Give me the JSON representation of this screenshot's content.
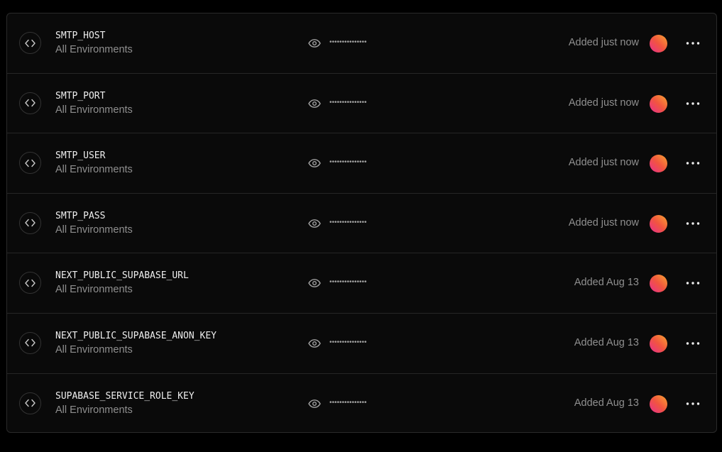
{
  "variables": [
    {
      "name": "SMTP_HOST",
      "environment": "All Environments",
      "masked_value": "•••••••••••••••",
      "added": "Added just now"
    },
    {
      "name": "SMTP_PORT",
      "environment": "All Environments",
      "masked_value": "•••••••••••••••",
      "added": "Added just now"
    },
    {
      "name": "SMTP_USER",
      "environment": "All Environments",
      "masked_value": "•••••••••••••••",
      "added": "Added just now"
    },
    {
      "name": "SMTP_PASS",
      "environment": "All Environments",
      "masked_value": "•••••••••••••••",
      "added": "Added just now"
    },
    {
      "name": "NEXT_PUBLIC_SUPABASE_URL",
      "environment": "All Environments",
      "masked_value": "•••••••••••••••",
      "added": "Added Aug 13"
    },
    {
      "name": "NEXT_PUBLIC_SUPABASE_ANON_KEY",
      "environment": "All Environments",
      "masked_value": "•••••••••••••••",
      "added": "Added Aug 13"
    },
    {
      "name": "SUPABASE_SERVICE_ROLE_KEY",
      "environment": "All Environments",
      "masked_value": "•••••••••••••••",
      "added": "Added Aug 13"
    }
  ],
  "icons": {
    "row_icon": "code-icon",
    "reveal_icon": "eye-icon",
    "menu_icon": "ellipsis-icon"
  },
  "colors": {
    "background": "#000000",
    "panel": "#0a0a0a",
    "border": "#262626",
    "name_text": "#ededed",
    "muted_text": "#8f8f8f",
    "avatar_gradient": [
      "#e8308f",
      "#f2553f",
      "#f7a531"
    ]
  }
}
